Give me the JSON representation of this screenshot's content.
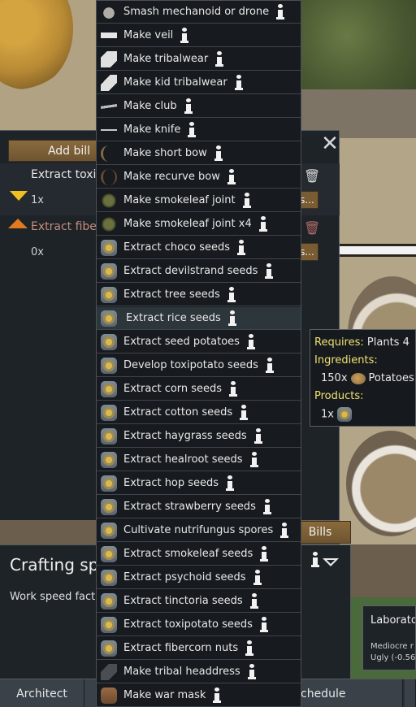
{
  "bills_panel": {
    "add_bill_label": "Add bill",
    "bills": [
      {
        "name": "Extract toxipo",
        "count": "1x",
        "details_label": "s..."
      },
      {
        "name": "Extract fiberc",
        "count": "0x",
        "details_label": "s..."
      }
    ]
  },
  "lower_panel": {
    "title": "Crafting spo",
    "work_speed_text": "Work speed facto",
    "bills_tab_label": "Bills"
  },
  "bottom_bar": {
    "tabs": [
      "Architect",
      "",
      "chedule",
      ""
    ]
  },
  "menu": {
    "hovered_index": 13,
    "items": [
      {
        "label": "Smash mechanoid or drone",
        "icon": "mechanoid-icon"
      },
      {
        "label": "Make veil",
        "icon": "veil-icon"
      },
      {
        "label": "Make tribalwear",
        "icon": "tribalwear-icon"
      },
      {
        "label": "Make kid tribalwear",
        "icon": "kid-tribalwear-icon"
      },
      {
        "label": "Make club",
        "icon": "club-icon"
      },
      {
        "label": "Make knife",
        "icon": "knife-icon"
      },
      {
        "label": "Make short bow",
        "icon": "short-bow-icon"
      },
      {
        "label": "Make recurve bow",
        "icon": "recurve-bow-icon"
      },
      {
        "label": "Make smokeleaf joint",
        "icon": "smokeleaf-joint-icon"
      },
      {
        "label": "Make smokeleaf joint x4",
        "icon": "smokeleaf-joint-icon"
      },
      {
        "label": "Extract choco seeds",
        "icon": "seed-icon"
      },
      {
        "label": "Extract devilstrand seeds",
        "icon": "seed-icon"
      },
      {
        "label": "Extract tree seeds",
        "icon": "seed-icon"
      },
      {
        "label": "Extract rice seeds",
        "icon": "seed-icon"
      },
      {
        "label": "Extract seed potatoes",
        "icon": "seed-icon"
      },
      {
        "label": "Develop toxipotato seeds",
        "icon": "seed-icon"
      },
      {
        "label": "Extract corn seeds",
        "icon": "seed-icon"
      },
      {
        "label": "Extract cotton seeds",
        "icon": "seed-icon"
      },
      {
        "label": "Extract haygrass seeds",
        "icon": "seed-icon"
      },
      {
        "label": "Extract healroot seeds",
        "icon": "seed-icon"
      },
      {
        "label": "Extract hop seeds",
        "icon": "seed-icon"
      },
      {
        "label": "Extract strawberry seeds",
        "icon": "seed-icon"
      },
      {
        "label": "Cultivate nutrifungus spores",
        "icon": "seed-icon"
      },
      {
        "label": "Extract smokeleaf seeds",
        "icon": "seed-icon"
      },
      {
        "label": "Extract psychoid seeds",
        "icon": "seed-icon"
      },
      {
        "label": "Extract tinctoria seeds",
        "icon": "seed-icon"
      },
      {
        "label": "Extract toxipotato seeds",
        "icon": "seed-icon"
      },
      {
        "label": "Extract fibercorn nuts",
        "icon": "seed-icon"
      },
      {
        "label": "Make tribal headdress",
        "icon": "feather-icon"
      },
      {
        "label": "Make war mask",
        "icon": "war-mask-icon"
      }
    ]
  },
  "tooltip": {
    "requires_label": "Requires:",
    "requires_value": "Plants 4",
    "ingredients_label": "Ingredients:",
    "ingredient_qty": "150x",
    "ingredient_name": "Potatoes",
    "products_label": "Products:",
    "product_qty": "1x"
  },
  "lab_tooltip": {
    "title": "Laborato",
    "line1": "Mediocre r",
    "line2": "Ugly (-0.56"
  },
  "colors": {
    "panel_bg": "#1e2328",
    "menu_bg": "#171b1f",
    "button_brown": "#7a5c32",
    "tooltip_yellow": "#f0e070",
    "bill_orange_text": "#c58d7c"
  }
}
